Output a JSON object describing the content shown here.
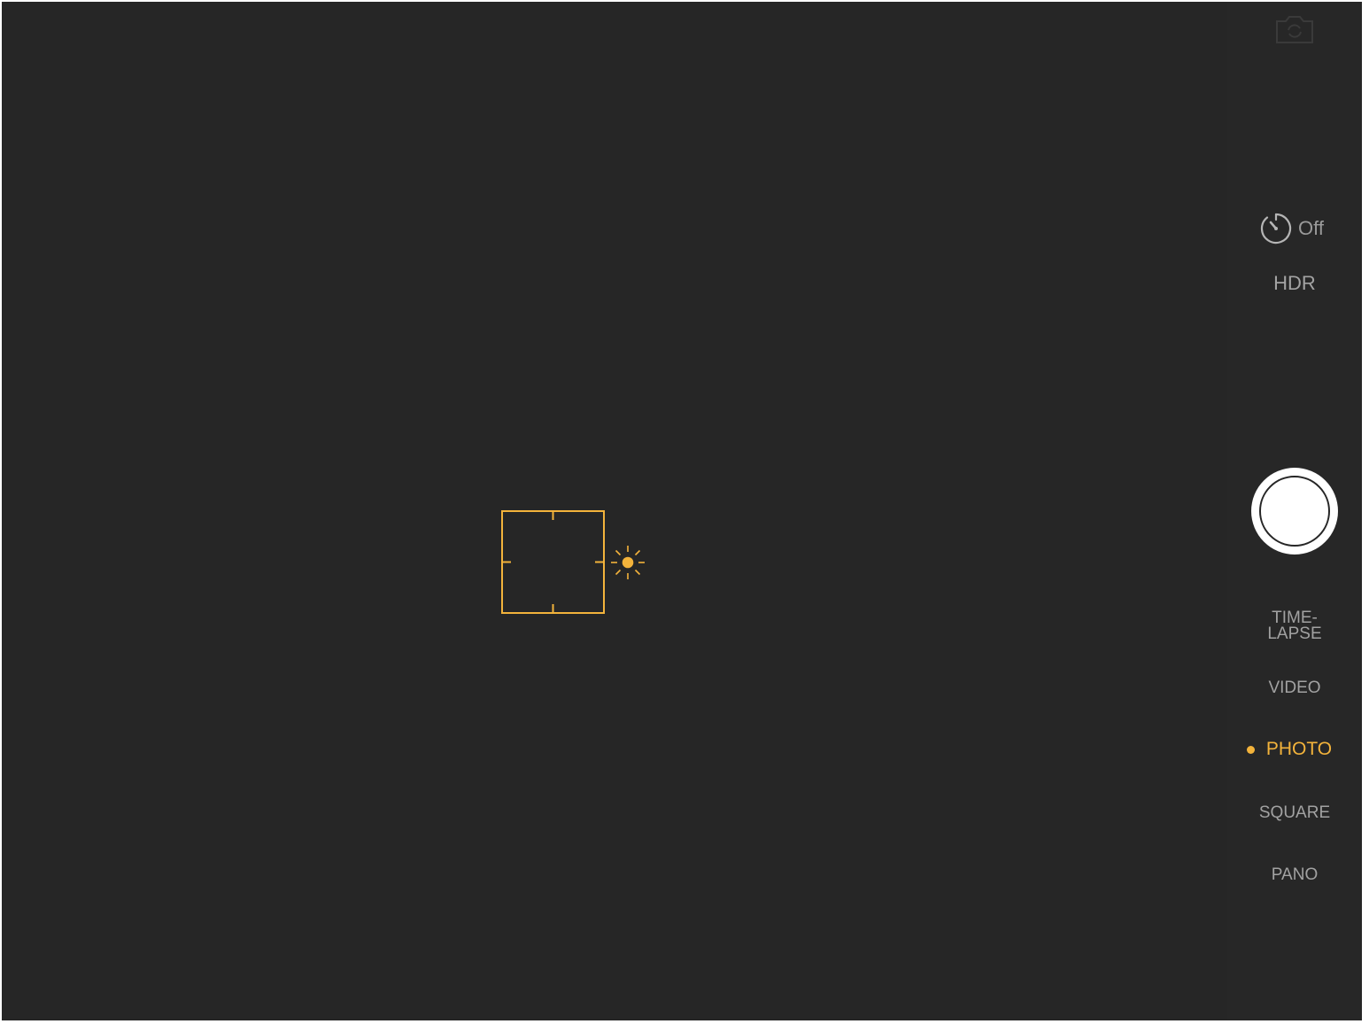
{
  "colors": {
    "background": "#262626",
    "accent": "#f3b33b",
    "text_muted": "#a2a2a2",
    "shutter": "#ffffff"
  },
  "viewfinder": {
    "focus_box_icon": "focus-square",
    "exposure_icon": "sun-icon"
  },
  "controls": {
    "flip_camera_icon": "camera-flip-icon",
    "timer": {
      "icon": "timer-icon",
      "label": "Off"
    },
    "hdr_label": "HDR",
    "shutter_icon": "shutter-button",
    "modes": [
      {
        "label": "TIME-\nLAPSE",
        "line1": "TIME-",
        "line2": "LAPSE",
        "active": false
      },
      {
        "label": "VIDEO",
        "active": false
      },
      {
        "label": "PHOTO",
        "active": true
      },
      {
        "label": "SQUARE",
        "active": false
      },
      {
        "label": "PANO",
        "active": false
      }
    ]
  }
}
